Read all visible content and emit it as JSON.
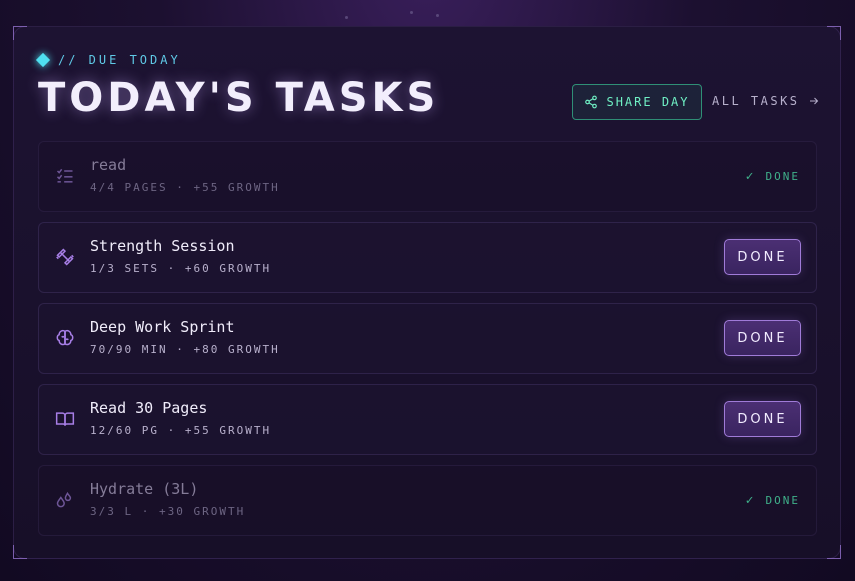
{
  "header": {
    "eyebrow": "// DUE TODAY",
    "title": "TODAY'S TASKS",
    "share_label": "SHARE DAY",
    "all_tasks_label": "ALL TASKS"
  },
  "tasks": [
    {
      "name": "read",
      "meta": "4/4 PAGES · +55 GROWTH",
      "completed": true,
      "status_label": "DONE",
      "icon": "checklist-icon"
    },
    {
      "name": "Strength Session",
      "meta": "1/3 SETS · +60 GROWTH",
      "completed": false,
      "button_label": "DONE",
      "icon": "dumbbell-icon"
    },
    {
      "name": "Deep Work Sprint",
      "meta": "70/90 MIN · +80 GROWTH",
      "completed": false,
      "button_label": "DONE",
      "icon": "brain-icon"
    },
    {
      "name": "Read 30 Pages",
      "meta": "12/60 PG · +55 GROWTH",
      "completed": false,
      "button_label": "DONE",
      "icon": "book-icon"
    },
    {
      "name": "Hydrate (3L)",
      "meta": "3/3 L · +30 GROWTH",
      "completed": true,
      "status_label": "DONE",
      "icon": "droplets-icon"
    }
  ],
  "colors": {
    "accent_cyan": "#4fe0f0",
    "accent_green": "#6ff0c4",
    "accent_purple": "#a07bd8",
    "background": "#170f28"
  }
}
